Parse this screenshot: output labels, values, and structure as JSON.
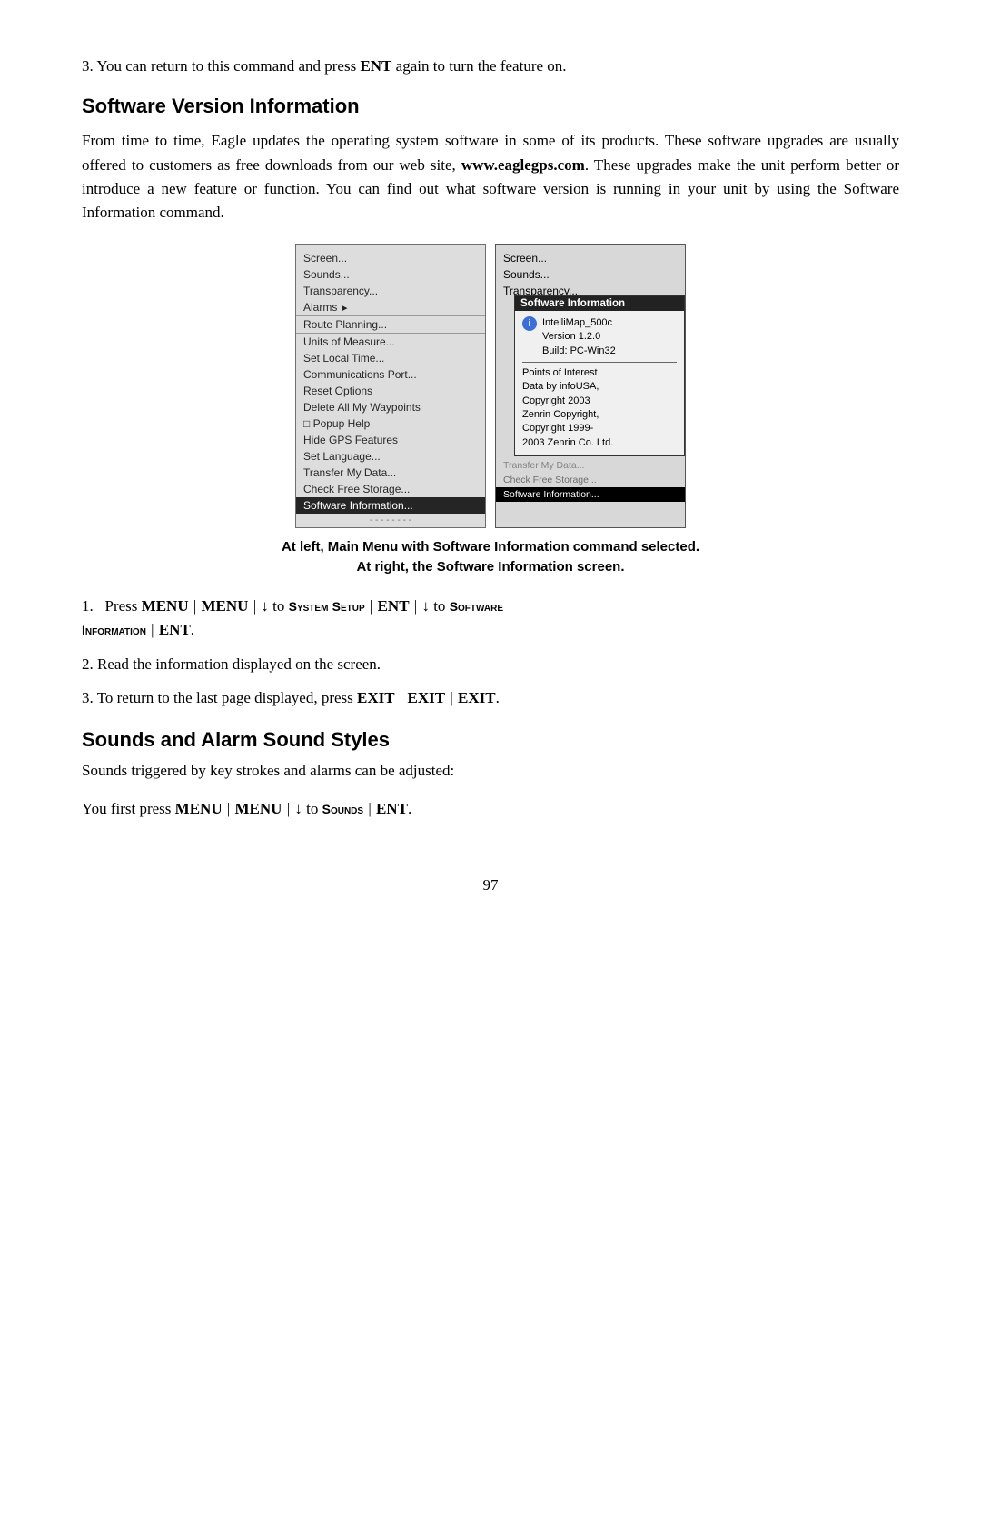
{
  "intro": {
    "paragraph": "3. You can return to this command and press ENT again to turn the feature on."
  },
  "software_section": {
    "heading": "Software Version Information",
    "body": "From time to time, Eagle updates the operating system software in some of its products. These software upgrades are usually offered to customers as free downloads from our web site, www.eaglegps.com. These upgrades make the unit perform better or introduce a new feature or function. You can find out what software version is running in your unit by using the Software Information command.",
    "website_bold": "www.eaglegps.com"
  },
  "left_menu": {
    "items": [
      {
        "label": "Screen...",
        "selected": false,
        "sep": false
      },
      {
        "label": "Sounds...",
        "selected": false,
        "sep": false
      },
      {
        "label": "Transparency...",
        "selected": false,
        "sep": false
      },
      {
        "label": "Alarms ►",
        "selected": false,
        "sep": false
      },
      {
        "label": "Route Planning...",
        "selected": false,
        "sep": true
      },
      {
        "label": "Units of Measure...",
        "selected": false,
        "sep": true
      },
      {
        "label": "Set Local Time...",
        "selected": false,
        "sep": false
      },
      {
        "label": "Communications Port...",
        "selected": false,
        "sep": false
      },
      {
        "label": "Reset Options",
        "selected": false,
        "sep": false
      },
      {
        "label": "Delete All My Waypoints",
        "selected": false,
        "sep": false
      },
      {
        "label": "□ Popup Help",
        "selected": false,
        "sep": false
      },
      {
        "label": "Hide GPS Features",
        "selected": false,
        "sep": false
      },
      {
        "label": "Set Language...",
        "selected": false,
        "sep": false
      },
      {
        "label": "Transfer My Data...",
        "selected": false,
        "sep": false
      },
      {
        "label": "Check Free Storage...",
        "selected": false,
        "sep": false
      },
      {
        "label": "Software Information...",
        "selected": true,
        "sep": false
      }
    ]
  },
  "right_menu": {
    "top_items": [
      {
        "label": "Screen..."
      },
      {
        "label": "Sounds..."
      },
      {
        "label": "Transparency..."
      }
    ],
    "popup_title": "Software Information",
    "popup_app_name": "IntelliMap_500c",
    "popup_version": "Version 1.2.0",
    "popup_build": "Build: PC-Win32",
    "popup_poi_title": "Points of Interest",
    "popup_poi_data": "Data by infoUSA,",
    "popup_copyright1": "Copyright 2003",
    "popup_zenrin": "Zenrin Copyright,",
    "popup_copyright2": "Copyright 1999-",
    "popup_year": "2003 Zenrin Co. Ltd.",
    "bottom_items": [
      {
        "label": "Transfer My Data..."
      },
      {
        "label": "Check Free Storage..."
      },
      {
        "label": "Software Information...",
        "selected": true
      }
    ]
  },
  "caption": {
    "line1": "At left, Main Menu with Software Information command selected.",
    "line2": "At right, the Software Information screen."
  },
  "steps": {
    "step1_prefix": "1. Press",
    "step1_menu1": "MENU",
    "step1_pipe1": "|",
    "step1_menu2": "MENU",
    "step1_pipe2": "|",
    "step1_arrow1": "↓",
    "step1_to1": "to",
    "step1_system": "System",
    "step1_setup": "Setup",
    "step1_pipe3": "|",
    "step1_ent1": "ENT",
    "step1_pipe4": "|",
    "step1_arrow2": "↓",
    "step1_to2": "to",
    "step1_software": "Software",
    "step1_information": "Information",
    "step1_pipe5": "|",
    "step1_ent2": "ENT",
    "step2": "2. Read the information displayed on the screen.",
    "step3_prefix": "3. To return to the last page displayed, press",
    "step3_exit1": "EXIT",
    "step3_pipe1": "|",
    "step3_exit2": "EXIT",
    "step3_pipe2": "|",
    "step3_exit3": "EXIT",
    "step3_suffix": "."
  },
  "sounds_section": {
    "heading": "Sounds and Alarm Sound Styles",
    "body1": "Sounds triggered by key strokes and alarms can be adjusted:",
    "body2_prefix": "You first press",
    "body2_menu1": "MENU",
    "body2_pipe1": "|",
    "body2_menu2": "MENU",
    "body2_pipe2": "|",
    "body2_arrow": "↓",
    "body2_to": "to",
    "body2_sounds": "Sounds",
    "body2_pipe3": "|",
    "body2_ent": "ENT",
    "body2_suffix": "."
  },
  "page_number": "97"
}
